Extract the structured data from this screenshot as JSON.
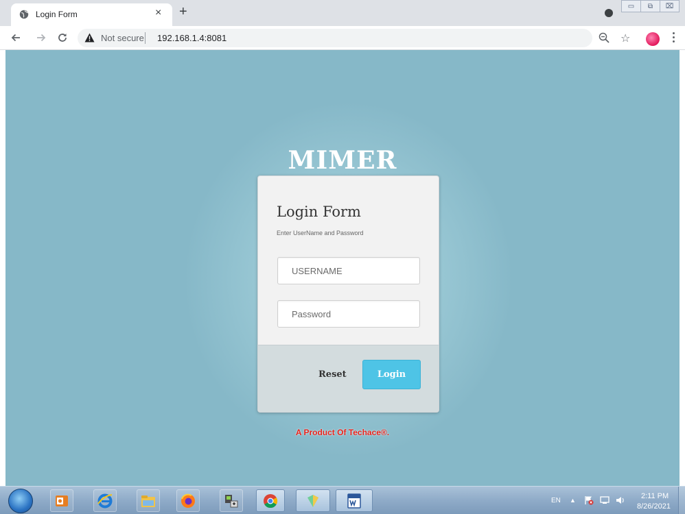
{
  "browser": {
    "tab": {
      "title": "Login Form",
      "close_glyph": "×"
    },
    "new_tab_glyph": "+",
    "window_controls": {
      "minimize": "▭",
      "maximize": "⧉",
      "close": "⌧"
    },
    "address": {
      "security_label": "Not secure",
      "url": "192.168.1.4:8081"
    }
  },
  "page": {
    "brand": "MIMER",
    "form": {
      "title": "Login Form",
      "hint": "Enter UserName and Password",
      "username_placeholder": "USERNAME",
      "password_placeholder": "Password",
      "reset_label": "Reset",
      "login_label": "Login"
    },
    "footer_text": "A Product Of Techace®."
  },
  "taskbar": {
    "language": "EN",
    "tray_arrow": "▲",
    "time": "2:11 PM",
    "date": "8/26/2021"
  },
  "colors": {
    "page_background": "#86b8c8",
    "login_button": "#4ec4e6",
    "footer_text": "#e8231c",
    "card_footer": "#d3dcde"
  },
  "icons": {
    "tab": "globe-icon",
    "nav": [
      "back-arrow-icon",
      "forward-arrow-icon",
      "reload-icon"
    ],
    "omnibox": [
      "warning-triangle-icon",
      "zoom-icon"
    ],
    "toolbar": [
      "star-icon",
      "profile-icon",
      "menu-icon"
    ],
    "taskbar": [
      "start-orb-icon",
      "outlook-icon",
      "internet-explorer-icon",
      "file-explorer-icon",
      "firefox-icon",
      "network-tool-icon",
      "chrome-icon",
      "app-icon",
      "word-icon"
    ],
    "tray": [
      "flag-warning-icon",
      "network-icon",
      "volume-icon"
    ]
  }
}
